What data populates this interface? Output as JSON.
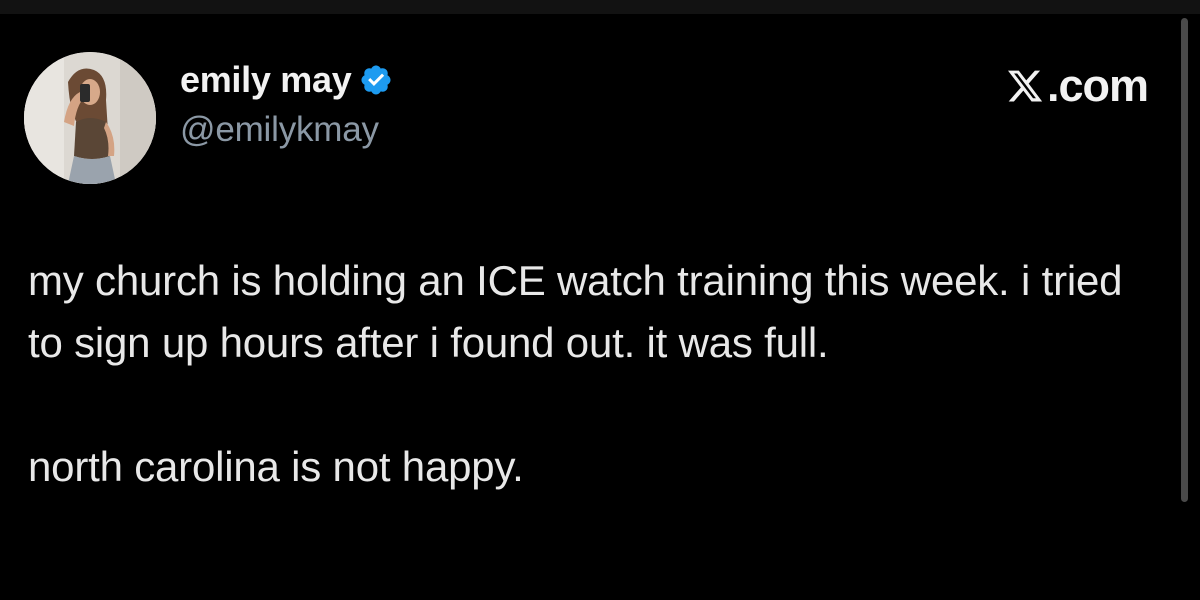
{
  "author": {
    "display_name": "emily may",
    "handle": "@emilykmay",
    "verified": true,
    "verified_icon": "verified-badge-icon",
    "verified_color": "#1d9bf0",
    "avatar_icon": "profile-photo"
  },
  "brand": {
    "logo_icon": "x-logo-icon",
    "text": ".com"
  },
  "tweet": {
    "paragraph_1": "my church is holding an ICE watch training this week. i tried to sign up hours after i found out. it was full.",
    "paragraph_2": "north carolina is not happy."
  },
  "colors": {
    "background": "#000000",
    "text": "#e7e9ea",
    "secondary_text": "#8b98a5"
  }
}
